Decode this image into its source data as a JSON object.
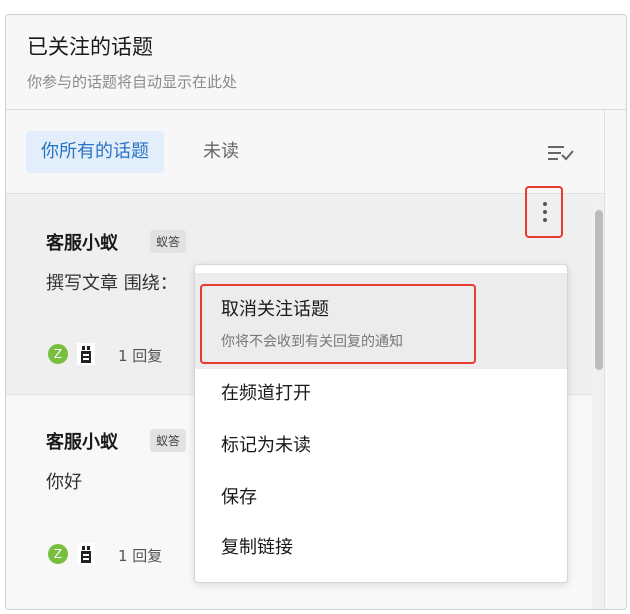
{
  "header": {
    "title": "已关注的话题",
    "subtitle": "你参与的话题将自动显示在此处"
  },
  "tabs": [
    {
      "label": "你所有的话题",
      "active": true
    },
    {
      "label": "未读",
      "active": false
    }
  ],
  "icons": {
    "filter": "filter-check-icon",
    "more": "more-vertical-icon"
  },
  "topics": [
    {
      "author": "客服小蚁",
      "badge": "蚁答",
      "preview": "撰写文章 围绕：",
      "avatar_letter": "Z",
      "replies": "1 回复"
    },
    {
      "author": "客服小蚁",
      "badge": "蚁答",
      "preview": "你好",
      "avatar_letter": "Z",
      "replies": "1 回复"
    }
  ],
  "context_menu": {
    "unfollow": {
      "title": "取消关注话题",
      "subtitle": "你将不会收到有关回复的通知"
    },
    "items": [
      "在频道打开",
      "标记为未读",
      "保存",
      "复制链接"
    ]
  },
  "colors": {
    "accent": "#2b73c4",
    "tab_active_bg": "#e2eef9",
    "highlight_border": "#e63b2e",
    "avatar_green": "#76bf3f"
  }
}
